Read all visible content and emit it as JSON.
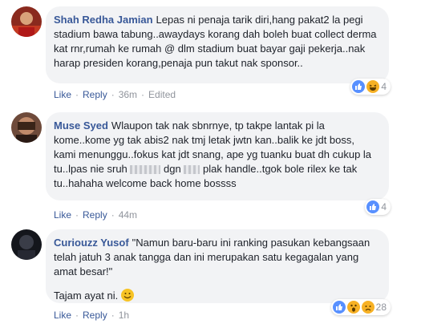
{
  "comments": [
    {
      "author": "Shah Redha Jamian",
      "text": "Lepas ni penaja tarik diri,hang pakat2 la pegi stadium bawa tabung..awaydays korang dah boleh buat collect derma kat rnr,rumah ke rumah @ dlm stadium buat bayar gaji pekerja..nak harap presiden korang,penaja pun takut nak sponsor..",
      "reaction_count": "4",
      "actions": {
        "like": "Like",
        "reply": "Reply",
        "time": "36m",
        "edited": "Edited"
      }
    },
    {
      "author": "Muse Syed",
      "text_a": "Wlaupon tak nak sbnrnye, tp takpe lantak pi la kome..kome yg tak abis2 nak tmj letak jwtn kan..balik ke jdt boss, kami menunggu..fokus kat jdt snang, ape yg tuanku buat dh cukup la tu..lpas nie sruh",
      "text_b": "dgn",
      "text_c": "plak handle..tgok bole rilex ke tak tu..hahaha welcome back home bossss",
      "reaction_count": "4",
      "actions": {
        "like": "Like",
        "reply": "Reply",
        "time": "44m"
      }
    },
    {
      "author": "Curiouzz Yusof",
      "text": "\"Namun baru-baru ini ranking pasukan kebangsaan telah jatuh 3 anak tangga dan ini merupakan satu kegagalan yang amat besar!\"",
      "text2": "Tajam ayat ni.",
      "reaction_count": "28",
      "actions": {
        "like": "Like",
        "reply": "Reply",
        "time": "1h"
      }
    }
  ],
  "icons": [
    "like-reaction-icon",
    "haha-reaction-icon",
    "wow-reaction-icon",
    "sad-reaction-icon",
    "smile-emoji-icon"
  ],
  "colors": {
    "link": "#385898",
    "bubble": "#f2f3f5",
    "muted": "#90949c",
    "like": "#5890ff"
  }
}
